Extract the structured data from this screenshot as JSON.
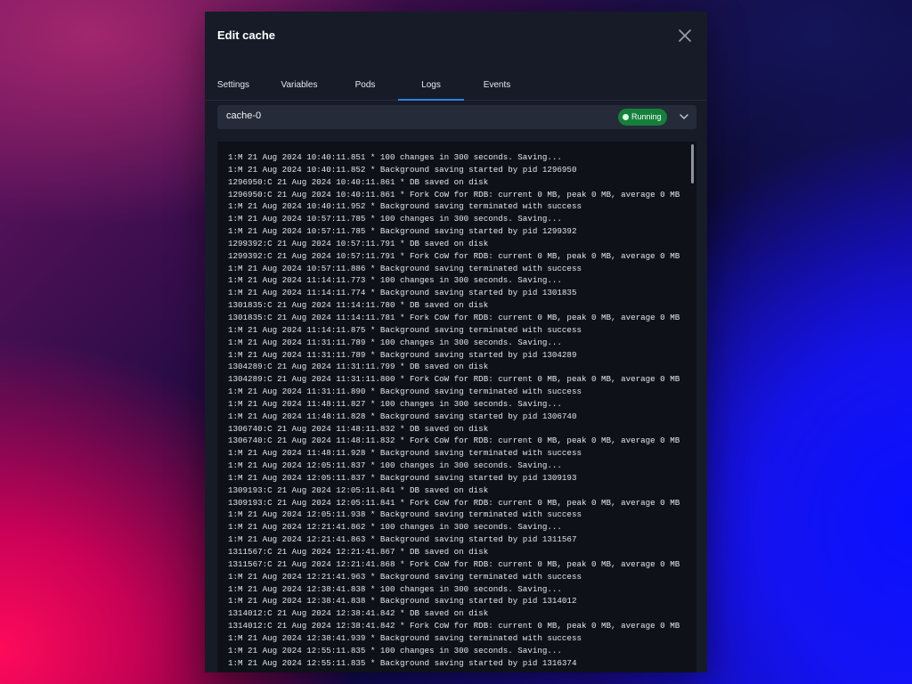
{
  "modal": {
    "title": "Edit cache"
  },
  "tabs": [
    {
      "label": "Settings",
      "active": false
    },
    {
      "label": "Variables",
      "active": false
    },
    {
      "label": "Pods",
      "active": false
    },
    {
      "label": "Logs",
      "active": true
    },
    {
      "label": "Events",
      "active": false
    }
  ],
  "pod_select": {
    "selected": "cache-0",
    "status": "Running",
    "status_color": "#14803c"
  },
  "colors": {
    "accent": "#2f7fe6",
    "modal_bg": "#161b27",
    "log_bg": "#0e1118"
  },
  "logs": [
    "1:M 21 Aug 2024 10:40:11.851 * 100 changes in 300 seconds. Saving...",
    "1:M 21 Aug 2024 10:40:11.852 * Background saving started by pid 1296950",
    "1296950:C 21 Aug 2024 10:40:11.861 * DB saved on disk",
    "1296950:C 21 Aug 2024 10:40:11.861 * Fork CoW for RDB: current 0 MB, peak 0 MB, average 0 MB",
    "1:M 21 Aug 2024 10:40:11.952 * Background saving terminated with success",
    "1:M 21 Aug 2024 10:57:11.785 * 100 changes in 300 seconds. Saving...",
    "1:M 21 Aug 2024 10:57:11.785 * Background saving started by pid 1299392",
    "1299392:C 21 Aug 2024 10:57:11.791 * DB saved on disk",
    "1299392:C 21 Aug 2024 10:57:11.791 * Fork CoW for RDB: current 0 MB, peak 0 MB, average 0 MB",
    "1:M 21 Aug 2024 10:57:11.886 * Background saving terminated with success",
    "1:M 21 Aug 2024 11:14:11.773 * 100 changes in 300 seconds. Saving...",
    "1:M 21 Aug 2024 11:14:11.774 * Background saving started by pid 1301835",
    "1301835:C 21 Aug 2024 11:14:11.780 * DB saved on disk",
    "1301835:C 21 Aug 2024 11:14:11.781 * Fork CoW for RDB: current 0 MB, peak 0 MB, average 0 MB",
    "1:M 21 Aug 2024 11:14:11.875 * Background saving terminated with success",
    "1:M 21 Aug 2024 11:31:11.789 * 100 changes in 300 seconds. Saving...",
    "1:M 21 Aug 2024 11:31:11.789 * Background saving started by pid 1304289",
    "1304289:C 21 Aug 2024 11:31:11.799 * DB saved on disk",
    "1304289:C 21 Aug 2024 11:31:11.800 * Fork CoW for RDB: current 0 MB, peak 0 MB, average 0 MB",
    "1:M 21 Aug 2024 11:31:11.890 * Background saving terminated with success",
    "1:M 21 Aug 2024 11:48:11.827 * 100 changes in 300 seconds. Saving...",
    "1:M 21 Aug 2024 11:48:11.828 * Background saving started by pid 1306740",
    "1306740:C 21 Aug 2024 11:48:11.832 * DB saved on disk",
    "1306740:C 21 Aug 2024 11:48:11.832 * Fork CoW for RDB: current 0 MB, peak 0 MB, average 0 MB",
    "1:M 21 Aug 2024 11:48:11.928 * Background saving terminated with success",
    "1:M 21 Aug 2024 12:05:11.837 * 100 changes in 300 seconds. Saving...",
    "1:M 21 Aug 2024 12:05:11.837 * Background saving started by pid 1309193",
    "1309193:C 21 Aug 2024 12:05:11.841 * DB saved on disk",
    "1309193:C 21 Aug 2024 12:05:11.841 * Fork CoW for RDB: current 0 MB, peak 0 MB, average 0 MB",
    "1:M 21 Aug 2024 12:05:11.938 * Background saving terminated with success",
    "1:M 21 Aug 2024 12:21:41.862 * 100 changes in 300 seconds. Saving...",
    "1:M 21 Aug 2024 12:21:41.863 * Background saving started by pid 1311567",
    "1311567:C 21 Aug 2024 12:21:41.867 * DB saved on disk",
    "1311567:C 21 Aug 2024 12:21:41.868 * Fork CoW for RDB: current 0 MB, peak 0 MB, average 0 MB",
    "1:M 21 Aug 2024 12:21:41.963 * Background saving terminated with success",
    "1:M 21 Aug 2024 12:38:41.838 * 100 changes in 300 seconds. Saving...",
    "1:M 21 Aug 2024 12:38:41.838 * Background saving started by pid 1314012",
    "1314012:C 21 Aug 2024 12:38:41.842 * DB saved on disk",
    "1314012:C 21 Aug 2024 12:38:41.842 * Fork CoW for RDB: current 0 MB, peak 0 MB, average 0 MB",
    "1:M 21 Aug 2024 12:38:41.939 * Background saving terminated with success",
    "1:M 21 Aug 2024 12:55:11.835 * 100 changes in 300 seconds. Saving...",
    "1:M 21 Aug 2024 12:55:11.835 * Background saving started by pid 1316374"
  ]
}
